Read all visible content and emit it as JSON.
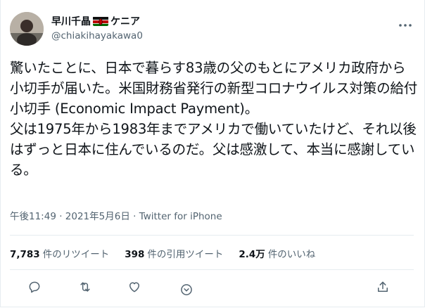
{
  "user": {
    "display_name": "早川千晶",
    "flag_suffix": "ケニア",
    "handle": "@chiakihayakawa0"
  },
  "tweet": {
    "text": "驚いたことに、日本で暮らす83歳の父のもとにアメリカ政府から小切手が届いた。米国財務省発行の新型コロナウイルス対策の給付小切手 (Economic Impact Payment)。\n父は1975年から1983年までアメリカで働いていたけど、それ以後はずっと日本に住んでいるのだ。父は感激して、本当に感謝している。",
    "time": "午後11:49",
    "separator1": " · ",
    "date": "2021年5月6日",
    "separator2": " · ",
    "source": "Twitter for iPhone"
  },
  "stats": {
    "retweets_count": "7,783",
    "retweets_label": "件のリツイート",
    "quotes_count": "398",
    "quotes_label": "件の引用ツイート",
    "likes_count": "2.4万",
    "likes_label": "件のいいね"
  },
  "icons": {
    "more": "more-icon",
    "reply": "reply-icon",
    "retweet": "retweet-icon",
    "like": "like-icon",
    "extra": "chevron-down-icon",
    "share": "share-icon"
  },
  "colors": {
    "text": "#0f1419",
    "secondary": "#536471",
    "divider": "#e6ecf0"
  }
}
